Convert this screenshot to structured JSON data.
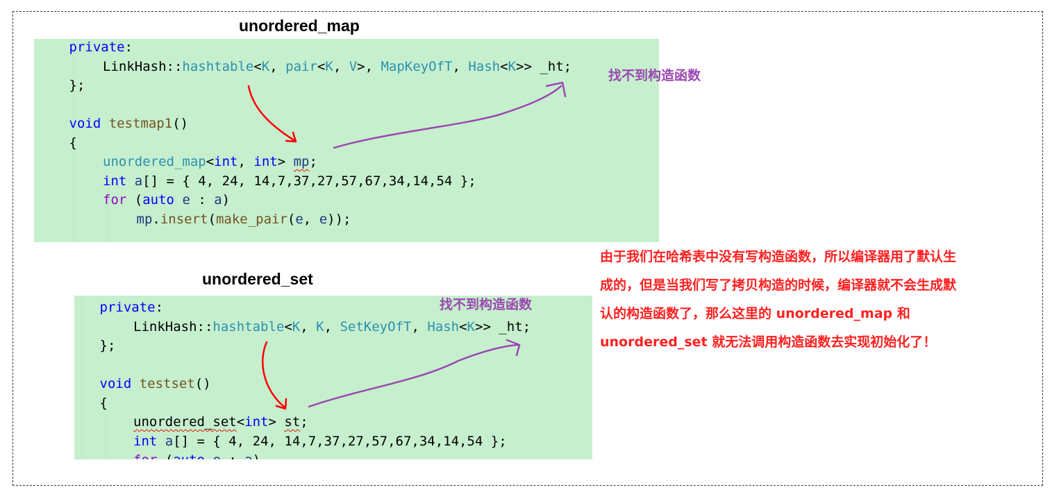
{
  "map_section": {
    "title": "unordered_map",
    "note": "找不到构造函数",
    "lines": [
      {
        "indent": 1,
        "tokens": [
          {
            "t": "private",
            "c": "kw"
          },
          {
            "t": ":",
            "c": "pl"
          }
        ]
      },
      {
        "indent": 2,
        "tokens": [
          {
            "t": "LinkHash::",
            "c": "pl"
          },
          {
            "t": "hashtable",
            "c": "ty"
          },
          {
            "t": "<",
            "c": "pl"
          },
          {
            "t": "K",
            "c": "tp"
          },
          {
            "t": ", ",
            "c": "pl"
          },
          {
            "t": "pair",
            "c": "ty"
          },
          {
            "t": "<",
            "c": "pl"
          },
          {
            "t": "K",
            "c": "tp"
          },
          {
            "t": ", ",
            "c": "pl"
          },
          {
            "t": "V",
            "c": "tp"
          },
          {
            "t": ">, ",
            "c": "pl"
          },
          {
            "t": "MapKeyOfT",
            "c": "ty"
          },
          {
            "t": ", ",
            "c": "pl"
          },
          {
            "t": "Hash",
            "c": "ty"
          },
          {
            "t": "<",
            "c": "pl"
          },
          {
            "t": "K",
            "c": "tp"
          },
          {
            "t": ">> _ht;",
            "c": "pl"
          }
        ]
      },
      {
        "indent": 1,
        "tokens": [
          {
            "t": "};",
            "c": "pl"
          }
        ]
      },
      {
        "indent": 0,
        "tokens": []
      },
      {
        "indent": 1,
        "tokens": [
          {
            "t": "void",
            "c": "kw"
          },
          {
            "t": " ",
            "c": "pl"
          },
          {
            "t": "testmap1",
            "c": "fn"
          },
          {
            "t": "()",
            "c": "pl"
          }
        ]
      },
      {
        "indent": 1,
        "tokens": [
          {
            "t": "{",
            "c": "pl"
          }
        ]
      },
      {
        "indent": 2,
        "tokens": [
          {
            "t": "unordered_map",
            "c": "ty"
          },
          {
            "t": "<",
            "c": "pl"
          },
          {
            "t": "int",
            "c": "kw"
          },
          {
            "t": ", ",
            "c": "pl"
          },
          {
            "t": "int",
            "c": "kw"
          },
          {
            "t": "> ",
            "c": "pl"
          },
          {
            "t": "mp",
            "c": "va",
            "s": true
          },
          {
            "t": ";",
            "c": "pl"
          }
        ]
      },
      {
        "indent": 2,
        "tokens": [
          {
            "t": "int",
            "c": "kw"
          },
          {
            "t": " ",
            "c": "pl"
          },
          {
            "t": "a",
            "c": "va"
          },
          {
            "t": "[] = { 4, 24, 14,7,37,27,57,67,34,14,54 };",
            "c": "pl"
          }
        ]
      },
      {
        "indent": 2,
        "tokens": [
          {
            "t": "for",
            "c": "mc"
          },
          {
            "t": " (",
            "c": "pl"
          },
          {
            "t": "auto",
            "c": "kw"
          },
          {
            "t": " ",
            "c": "pl"
          },
          {
            "t": "e",
            "c": "va"
          },
          {
            "t": " : ",
            "c": "pl"
          },
          {
            "t": "a",
            "c": "va"
          },
          {
            "t": ")",
            "c": "pl"
          }
        ]
      },
      {
        "indent": 3,
        "tokens": [
          {
            "t": "mp",
            "c": "va"
          },
          {
            "t": ".",
            "c": "pl"
          },
          {
            "t": "insert",
            "c": "fn"
          },
          {
            "t": "(",
            "c": "pl"
          },
          {
            "t": "make_pair",
            "c": "fn"
          },
          {
            "t": "(",
            "c": "pl"
          },
          {
            "t": "e",
            "c": "va"
          },
          {
            "t": ", ",
            "c": "pl"
          },
          {
            "t": "e",
            "c": "va"
          },
          {
            "t": "));",
            "c": "pl"
          }
        ]
      }
    ]
  },
  "set_section": {
    "title": "unordered_set",
    "note": "找不到构造函数",
    "lines": [
      {
        "indent": 1,
        "tokens": [
          {
            "t": "private",
            "c": "kw"
          },
          {
            "t": ":",
            "c": "pl"
          }
        ]
      },
      {
        "indent": 2,
        "tokens": [
          {
            "t": "LinkHash::",
            "c": "pl"
          },
          {
            "t": "hashtable",
            "c": "ty"
          },
          {
            "t": "<",
            "c": "pl"
          },
          {
            "t": "K",
            "c": "tp"
          },
          {
            "t": ", ",
            "c": "pl"
          },
          {
            "t": "K",
            "c": "tp"
          },
          {
            "t": ", ",
            "c": "pl"
          },
          {
            "t": "SetKeyOfT",
            "c": "ty"
          },
          {
            "t": ", ",
            "c": "pl"
          },
          {
            "t": "Hash",
            "c": "ty"
          },
          {
            "t": "<",
            "c": "pl"
          },
          {
            "t": "K",
            "c": "tp"
          },
          {
            "t": ">> _ht;",
            "c": "pl"
          }
        ]
      },
      {
        "indent": 1,
        "tokens": [
          {
            "t": "};",
            "c": "pl"
          }
        ]
      },
      {
        "indent": 0,
        "tokens": []
      },
      {
        "indent": 1,
        "tokens": [
          {
            "t": "void",
            "c": "kw"
          },
          {
            "t": " ",
            "c": "pl"
          },
          {
            "t": "testset",
            "c": "fn"
          },
          {
            "t": "()",
            "c": "pl"
          }
        ]
      },
      {
        "indent": 1,
        "tokens": [
          {
            "t": "{",
            "c": "pl"
          }
        ]
      },
      {
        "indent": 2,
        "tokens": [
          {
            "t": "unordered_set",
            "c": "pl",
            "s": true
          },
          {
            "t": "<",
            "c": "pl"
          },
          {
            "t": "int",
            "c": "kw"
          },
          {
            "t": "> ",
            "c": "pl"
          },
          {
            "t": "st",
            "c": "pl",
            "s": true
          },
          {
            "t": ";",
            "c": "pl"
          }
        ]
      },
      {
        "indent": 2,
        "tokens": [
          {
            "t": "int",
            "c": "kw"
          },
          {
            "t": " ",
            "c": "pl"
          },
          {
            "t": "a",
            "c": "va"
          },
          {
            "t": "[] = { 4, 24, 14,7,37,27,57,67,34,14,54 };",
            "c": "pl"
          }
        ]
      },
      {
        "indent": 2,
        "tokens": [
          {
            "t": "for",
            "c": "mc"
          },
          {
            "t": " (",
            "c": "pl"
          },
          {
            "t": "auto",
            "c": "kw"
          },
          {
            "t": " ",
            "c": "pl"
          },
          {
            "t": "e",
            "c": "va"
          },
          {
            "t": " : ",
            "c": "pl"
          },
          {
            "t": "a",
            "c": "va"
          },
          {
            "t": ")",
            "c": "pl"
          }
        ]
      }
    ]
  },
  "explanation": [
    "由于我们在哈希表中没有写构造函数，所以编译器用了默认生",
    "成的，但是当我们写了拷贝构造的时候，编译器就不会生成默",
    "认的构造函数了，那么这里的 unordered_map 和",
    "unordered_set 就无法调用构造函数去实现初始化了！"
  ],
  "colors": {
    "code_background": "#c6efce",
    "keyword": "#0000ff",
    "type": "#2b91af",
    "function": "#74531f",
    "variable": "#1f377f",
    "control": "#8f08c4",
    "note_purple": "#9b48b0",
    "explanation_red": "#ff2020",
    "arrow_red": "#ff0000",
    "arrow_purple": "#9b48b0"
  }
}
